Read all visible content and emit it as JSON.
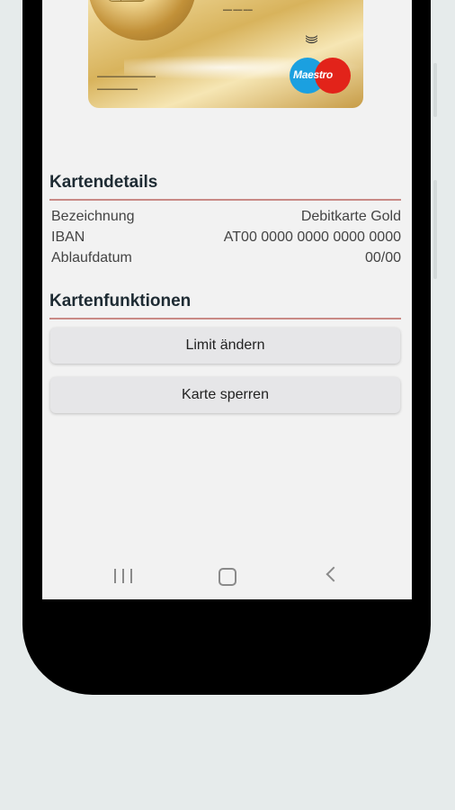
{
  "card": {
    "brand_label": "Maestro",
    "contactless_icon": "contactless-icon",
    "globe_icon": "globe-icon"
  },
  "details": {
    "title": "Kartendetails",
    "rows": [
      {
        "label": "Bezeichnung",
        "value": "Debitkarte Gold"
      },
      {
        "label": "IBAN",
        "value": "AT00 0000 0000 0000  0000"
      },
      {
        "label": "Ablaufdatum",
        "value": "00/00"
      }
    ]
  },
  "functions": {
    "title": "Kartenfunktionen",
    "limit_button": "Limit ändern",
    "block_button": "Karte sperren"
  },
  "navbar": {
    "recent_icon": "recent-apps-icon",
    "home_icon": "home-icon",
    "back_icon": "back-icon"
  },
  "colors": {
    "accent_line": "#c98a86",
    "screen_bg": "#f2f2f2",
    "button_bg": "#e6e6e8"
  }
}
